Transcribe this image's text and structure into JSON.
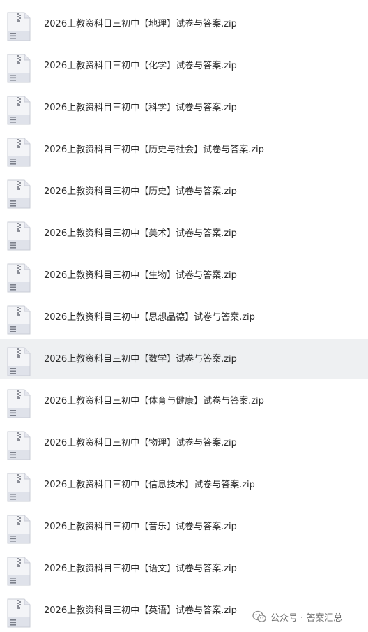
{
  "files": [
    {
      "name": "2026上教资科目三初中【地理】试卷与答案.zip",
      "selected": false
    },
    {
      "name": "2026上教资科目三初中【化学】试卷与答案.zip",
      "selected": false
    },
    {
      "name": "2026上教资科目三初中【科学】试卷与答案.zip",
      "selected": false
    },
    {
      "name": "2026上教资科目三初中【历史与社会】试卷与答案.zip",
      "selected": false
    },
    {
      "name": "2026上教资科目三初中【历史】试卷与答案.zip",
      "selected": false
    },
    {
      "name": "2026上教资科目三初中【美术】试卷与答案.zip",
      "selected": false
    },
    {
      "name": "2026上教资科目三初中【生物】试卷与答案.zip",
      "selected": false
    },
    {
      "name": "2026上教资科目三初中【思想品德】试卷与答案.zip",
      "selected": false
    },
    {
      "name": "2026上教资科目三初中【数学】试卷与答案.zip",
      "selected": true
    },
    {
      "name": "2026上教资科目三初中【体育与健康】试卷与答案.zip",
      "selected": false
    },
    {
      "name": "2026上教资科目三初中【物理】试卷与答案.zip",
      "selected": false
    },
    {
      "name": "2026上教资科目三初中【信息技术】试卷与答案.zip",
      "selected": false
    },
    {
      "name": "2026上教资科目三初中【音乐】试卷与答案.zip",
      "selected": false
    },
    {
      "name": "2026上教资科目三初中【语文】试卷与答案.zip",
      "selected": false
    },
    {
      "name": "2026上教资科目三初中【英语】试卷与答案.zip",
      "selected": false
    }
  ],
  "file_icon": "zip-archive-icon",
  "watermark": {
    "icon": "wechat-icon",
    "text": "公众号 · 答案汇总"
  },
  "colors": {
    "selected_row_bg": "#eef0f2",
    "text": "#2c2c2c",
    "watermark_text": "#6f6f6f"
  }
}
